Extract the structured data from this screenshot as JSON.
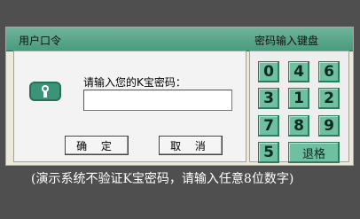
{
  "title_bar": {
    "left_title": "用户口令",
    "right_title": "密码输入键盘"
  },
  "dialog": {
    "prompt": "请输入您的K宝密码：",
    "password_value": "",
    "ok_label": "确 定",
    "cancel_label": "取 消"
  },
  "keypad": {
    "keys": [
      {
        "label": "0",
        "name": "key-0"
      },
      {
        "label": "4",
        "name": "key-4"
      },
      {
        "label": "6",
        "name": "key-6"
      },
      {
        "label": "3",
        "name": "key-3"
      },
      {
        "label": "1",
        "name": "key-1"
      },
      {
        "label": "2",
        "name": "key-2"
      },
      {
        "label": "7",
        "name": "key-7"
      },
      {
        "label": "8",
        "name": "key-8"
      },
      {
        "label": "9",
        "name": "key-9"
      },
      {
        "label": "5",
        "name": "key-5"
      }
    ],
    "backspace_label": "退格"
  },
  "note": "(演示系统不验证K宝密码，请输入任意8位数字)",
  "colors": {
    "background": "#4f4f4f",
    "title_bar": "#4a9b7e",
    "key": "#6fc0a0",
    "panel": "#ece9d8"
  },
  "icons": {
    "key_icon": "usb-key-icon"
  }
}
